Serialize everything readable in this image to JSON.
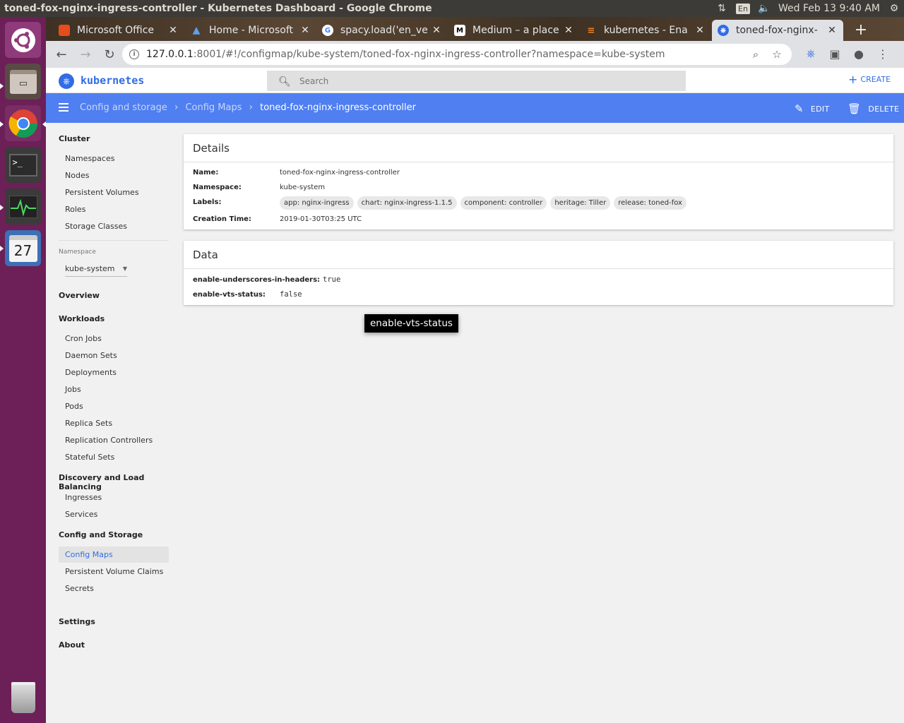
{
  "os": {
    "window_title": "toned-fox-nginx-ingress-controller - Kubernetes Dashboard - Google Chrome",
    "lang": "En",
    "clock": "Wed Feb 13  9:40 AM",
    "launcher_apps": [
      "ubuntu-dash-icon",
      "files-icon",
      "chrome-icon",
      "terminal-icon",
      "system-monitor-icon",
      "calendar-icon",
      "trash-icon"
    ],
    "calendar_day": "27"
  },
  "browser": {
    "tabs": [
      {
        "label": "Microsoft Office",
        "favicon": "office-icon",
        "color": "#e74c1c"
      },
      {
        "label": "Home - Microsoft",
        "favicon": "azure-icon",
        "color": "#2f6fd6"
      },
      {
        "label": "spacy.load('en_ve",
        "favicon": "google-icon",
        "color": "#4285f4"
      },
      {
        "label": "Medium – a place",
        "favicon": "medium-icon",
        "color": "#000000"
      },
      {
        "label": "kubernetes - Ena",
        "favicon": "stackoverflow-icon",
        "color": "#f48024"
      },
      {
        "label": "toned-fox-nginx-",
        "favicon": "kubernetes-icon",
        "color": "#326ce5"
      }
    ],
    "url_host": "127.0.0.1",
    "url_path": ":8001/#!/configmap/kube-system/toned-fox-nginx-ingress-controller?namespace=kube-system"
  },
  "header": {
    "brand": "kubernetes",
    "search_placeholder": "Search",
    "create_label": "CREATE"
  },
  "bluebar": {
    "crumbs": [
      "Config and storage",
      "Config Maps"
    ],
    "current": "toned-fox-nginx-ingress-controller",
    "edit_label": "EDIT",
    "delete_label": "DELETE"
  },
  "sidebar": {
    "cluster": "Cluster",
    "cluster_items": [
      "Namespaces",
      "Nodes",
      "Persistent Volumes",
      "Roles",
      "Storage Classes"
    ],
    "namespace_label": "Namespace",
    "namespace_value": "kube-system",
    "overview": "Overview",
    "workloads": "Workloads",
    "workload_items": [
      "Cron Jobs",
      "Daemon Sets",
      "Deployments",
      "Jobs",
      "Pods",
      "Replica Sets",
      "Replication Controllers",
      "Stateful Sets"
    ],
    "discovery": "Discovery and Load Balancing",
    "discovery_items": [
      "Ingresses",
      "Services"
    ],
    "config": "Config and Storage",
    "config_items": [
      "Config Maps",
      "Persistent Volume Claims",
      "Secrets"
    ],
    "settings": "Settings",
    "about": "About"
  },
  "details": {
    "title": "Details",
    "name_key": "Name:",
    "name": "toned-fox-nginx-ingress-controller",
    "namespace_key": "Namespace:",
    "namespace": "kube-system",
    "labels_key": "Labels:",
    "labels": [
      "app: nginx-ingress",
      "chart: nginx-ingress-1.1.5",
      "component: controller",
      "heritage: Tiller",
      "release: toned-fox"
    ],
    "creation_key": "Creation Time:",
    "creation": "2019-01-30T03:25 UTC"
  },
  "data": {
    "title": "Data",
    "entries": [
      {
        "key": "enable-underscores-in-headers:",
        "value": "true"
      },
      {
        "key": "enable-vts-status:",
        "value": "false"
      }
    ]
  },
  "tooltip": "enable-vts-status"
}
